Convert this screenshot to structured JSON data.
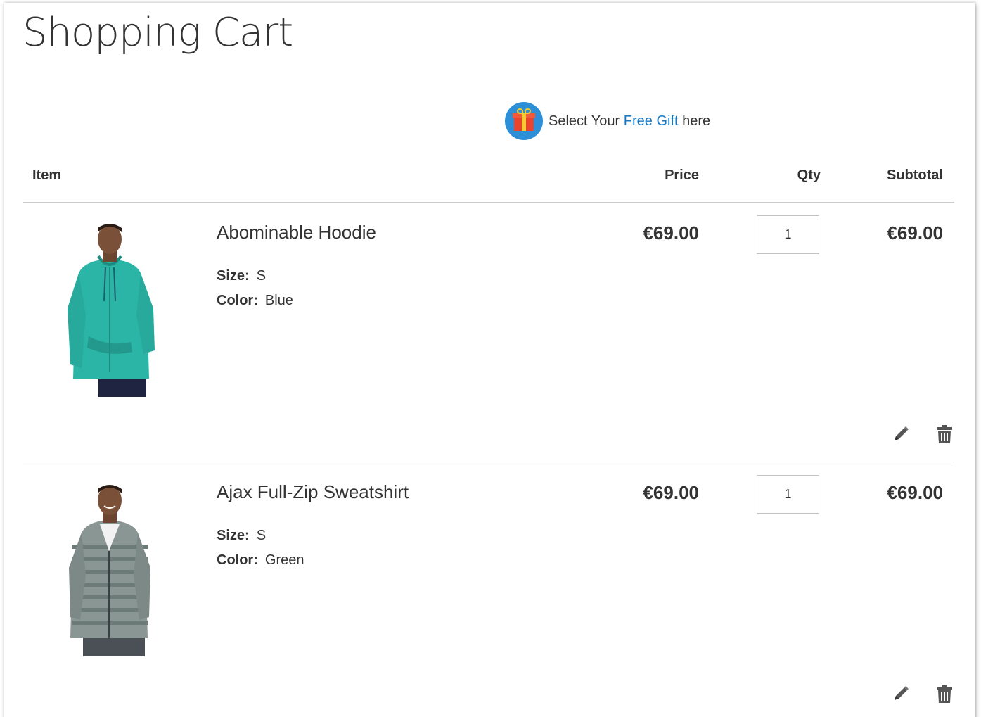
{
  "page": {
    "title": "Shopping Cart"
  },
  "gift_banner": {
    "prefix": "Select Your",
    "link": "Free Gift",
    "suffix": "here"
  },
  "table": {
    "headers": {
      "item": "Item",
      "price": "Price",
      "qty": "Qty",
      "subtotal": "Subtotal"
    }
  },
  "items": [
    {
      "name": "Abominable Hoodie",
      "size_label": "Size:",
      "size": "S",
      "color_label": "Color:",
      "color": "Blue",
      "price": "€69.00",
      "qty": "1",
      "subtotal": "€69.00"
    },
    {
      "name": "Ajax Full-Zip Sweatshirt",
      "size_label": "Size:",
      "size": "S",
      "color_label": "Color:",
      "color": "Green",
      "price": "€69.00",
      "qty": "1",
      "subtotal": "€69.00"
    }
  ],
  "icons": {
    "gift": "gift-icon",
    "edit": "pencil-icon",
    "delete": "trash-icon"
  },
  "colors": {
    "link": "#1979c3",
    "gift_circle": "#2d8fd8",
    "gift_box": "#e8452c",
    "ribbon": "#f7c932"
  }
}
